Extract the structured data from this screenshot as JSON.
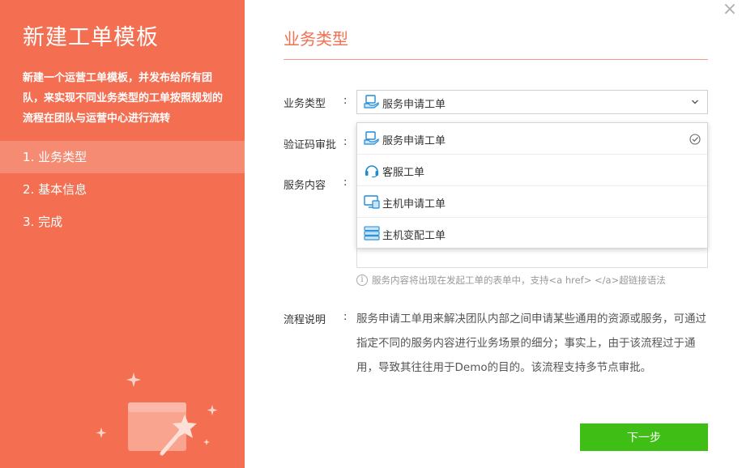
{
  "sidebar": {
    "title": "新建工单模板",
    "description": "新建一个运营工单模板，并发布给所有团队，来实现不同业务类型的工单按照规划的流程在团队与运营中心进行流转",
    "steps": [
      {
        "label": "1. 业务类型",
        "active": true
      },
      {
        "label": "2. 基本信息",
        "active": false
      },
      {
        "label": "3. 完成",
        "active": false
      }
    ]
  },
  "main": {
    "title": "业务类型",
    "fields": {
      "business_type_label": "业务类型",
      "captcha_label": "验证码审批",
      "service_content_label": "服务内容",
      "flow_label": "流程说明",
      "colon": ":"
    },
    "select": {
      "value": "服务申请工单",
      "icon": "service-request-icon"
    },
    "dropdown": {
      "options": [
        {
          "label": "服务申请工单",
          "icon": "service-request-icon",
          "selected": true
        },
        {
          "label": "客服工单",
          "icon": "headset-icon",
          "selected": false
        },
        {
          "label": "主机申请工单",
          "icon": "host-request-icon",
          "selected": false
        },
        {
          "label": "主机变配工单",
          "icon": "host-config-icon",
          "selected": false
        }
      ]
    },
    "hint": "服务内容将出现在发起工单的表单中，支持<a href> </a>超链接语法",
    "flow_description": "服务申请工单用来解决团队内部之间申请某些通用的资源或服务，可通过指定不同的服务内容进行业务场景的细分；事实上，由于该流程过于通用，导致其往往用于Demo的目的。该流程支持多节点审批。",
    "next_button": "下一步",
    "close_glyph": "×"
  },
  "colors": {
    "accent": "#f46f52",
    "primary_button": "#3fbf16",
    "icon_blue": "#1f8bd6"
  }
}
